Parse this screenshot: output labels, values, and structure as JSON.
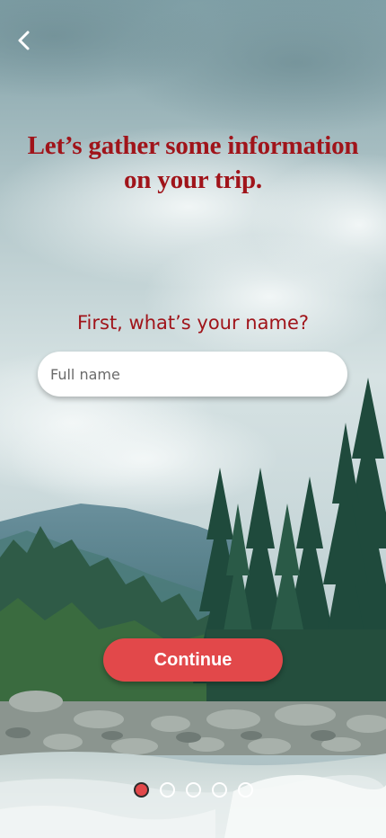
{
  "header": {
    "back_icon": "chevron-left-icon",
    "headline": "Let’s gather some information on your trip."
  },
  "form": {
    "question": "First, what’s your name?",
    "name_value": "",
    "name_placeholder": "Full name"
  },
  "actions": {
    "continue_label": "Continue"
  },
  "pager": {
    "total_steps": 5,
    "current_step": 1
  },
  "colors": {
    "accent": "#e2484a",
    "headline": "#a0141a"
  }
}
